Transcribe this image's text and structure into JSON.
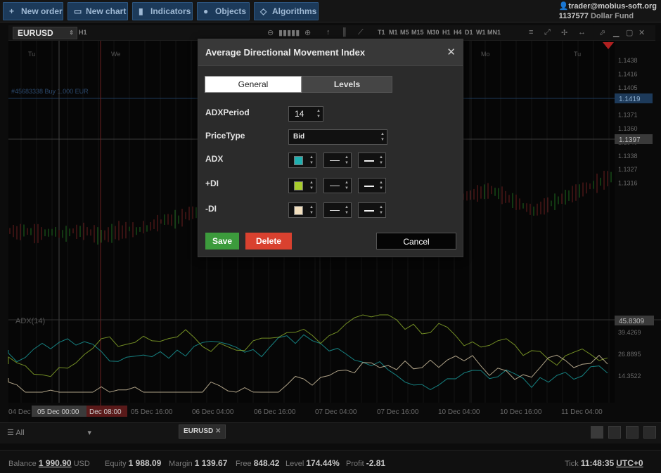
{
  "toolbar": {
    "new_order": "New order",
    "new_chart": "New chart",
    "indicators": "Indicators",
    "objects": "Objects",
    "algorithms": "Algorithms"
  },
  "account": {
    "user": "trader@mobius-soft.org",
    "number": "1137577",
    "fund": "Dollar Fund"
  },
  "chart": {
    "symbol": "EURUSD",
    "timeframe": "H1",
    "timeframes": [
      "T1",
      "M1",
      "M5",
      "M15",
      "M30",
      "H1",
      "H4",
      "D1",
      "W1",
      "MN1"
    ],
    "day_labels": [
      "Tu",
      "We",
      "Mo",
      "Tu"
    ],
    "order_line_label": "#45683338 Buy 1.000 EUR",
    "price_ticks": [
      "1.1438",
      "1.1416",
      "1.1405",
      "1.1383",
      "1.1371",
      "1.1360",
      "1.1349",
      "1.1338",
      "1.1327",
      "1.1316"
    ],
    "price_badge_1": "1.1419",
    "price_badge_2": "1.1397",
    "indicator_label": "ADX(14)",
    "indicator_badge": "45.8309",
    "indicator_ticks": [
      "39.4269",
      "26.8895",
      "14.3522"
    ],
    "time_labels": [
      "04 Dec",
      "05 Dec 16:00",
      "06 Dec 04:00",
      "06 Dec 16:00",
      "07 Dec 04:00",
      "07 Dec 16:00",
      "10 Dec 04:00",
      "10 Dec 16:00",
      "11 Dec 04:00"
    ],
    "cursor_time": "05 Dec 00:00",
    "cursor_time_2": "Dec 08:00"
  },
  "dialog": {
    "title": "Average Directional Movement Index",
    "tab_general": "General",
    "tab_levels": "Levels",
    "adx_period_label": "ADXPeriod",
    "adx_period_value": "14",
    "price_type_label": "PriceType",
    "price_type_value": "Bid",
    "adx_label": "ADX",
    "plus_di_label": "+DI",
    "minus_di_label": "-DI",
    "adx_color": "#1fb0b0",
    "plus_di_color": "#a8cc2c",
    "minus_di_color": "#f2dfbe",
    "save": "Save",
    "delete": "Delete",
    "cancel": "Cancel"
  },
  "bottom": {
    "filter": "All",
    "tab_symbol": "EURUSD"
  },
  "status": {
    "balance_label": "Balance",
    "balance": "1 990.90",
    "currency": "USD",
    "equity_label": "Equity",
    "equity": "1 988.09",
    "margin_label": "Margin",
    "margin": "1 139.67",
    "free_label": "Free",
    "free": "848.42",
    "level_label": "Level",
    "level": "174.44%",
    "profit_label": "Profit",
    "profit": "-2.81",
    "tick_label": "Tick",
    "tick": "11:48:35",
    "tz": "UTC+0"
  }
}
